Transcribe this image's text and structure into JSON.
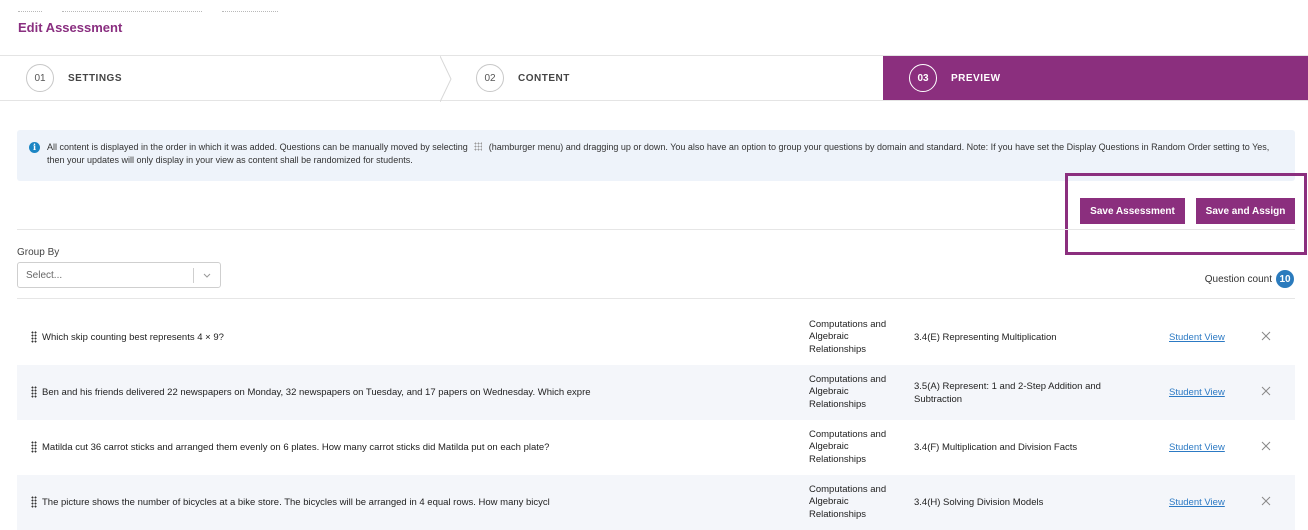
{
  "header": {
    "title": "Edit Assessment"
  },
  "stepper": {
    "steps": [
      {
        "number": "01",
        "label": "SETTINGS"
      },
      {
        "number": "02",
        "label": "CONTENT"
      },
      {
        "number": "03",
        "label": "PREVIEW"
      }
    ],
    "active_color": "#8b2f7e"
  },
  "info": {
    "icon": "info-icon",
    "text_before": "All content is displayed in the order in which it was added. Questions can be manually moved by selecting",
    "text_after": "(hamburger menu) and dragging up or down. You also have an option to group your questions by domain and standard. Note: If you have set the Display Questions in Random Order setting to Yes, then your updates will only display in your view as content shall be randomized for students."
  },
  "actions": {
    "save_label": "Save Assessment",
    "assign_label": "Save and Assign"
  },
  "group_by": {
    "label": "Group By",
    "placeholder": "Select..."
  },
  "question_count": {
    "label": "Question count",
    "value": "10"
  },
  "questions": [
    {
      "text": "Which skip counting best represents 4 × 9?",
      "domain": [
        "Computations and",
        "Algebraic",
        "Relationships"
      ],
      "standard": "3.4(E) Representing Multiplication",
      "link": "Student View"
    },
    {
      "text": "Ben and his friends delivered 22 newspapers on Monday, 32 newspapers on Tuesday, and 17 papers on Wednesday. Which expre",
      "domain": [
        "Computations and",
        "Algebraic",
        "Relationships"
      ],
      "standard": "3.5(A) Represent: 1 and 2-Step Addition and Subtraction",
      "link": "Student View"
    },
    {
      "text": "Matilda cut 36 carrot sticks and arranged them evenly on 6 plates. How many carrot sticks did Matilda put on each plate?",
      "domain": [
        "Computations and",
        "Algebraic",
        "Relationships"
      ],
      "standard": "3.4(F) Multiplication and Division Facts",
      "link": "Student View"
    },
    {
      "text": "The picture shows the number of bicycles at a bike store. The bicycles will be arranged in 4 equal rows. How many bicycl",
      "domain": [
        "Computations and",
        "Algebraic",
        "Relationships"
      ],
      "standard": "3.4(H) Solving Division Models",
      "link": "Student View"
    }
  ]
}
